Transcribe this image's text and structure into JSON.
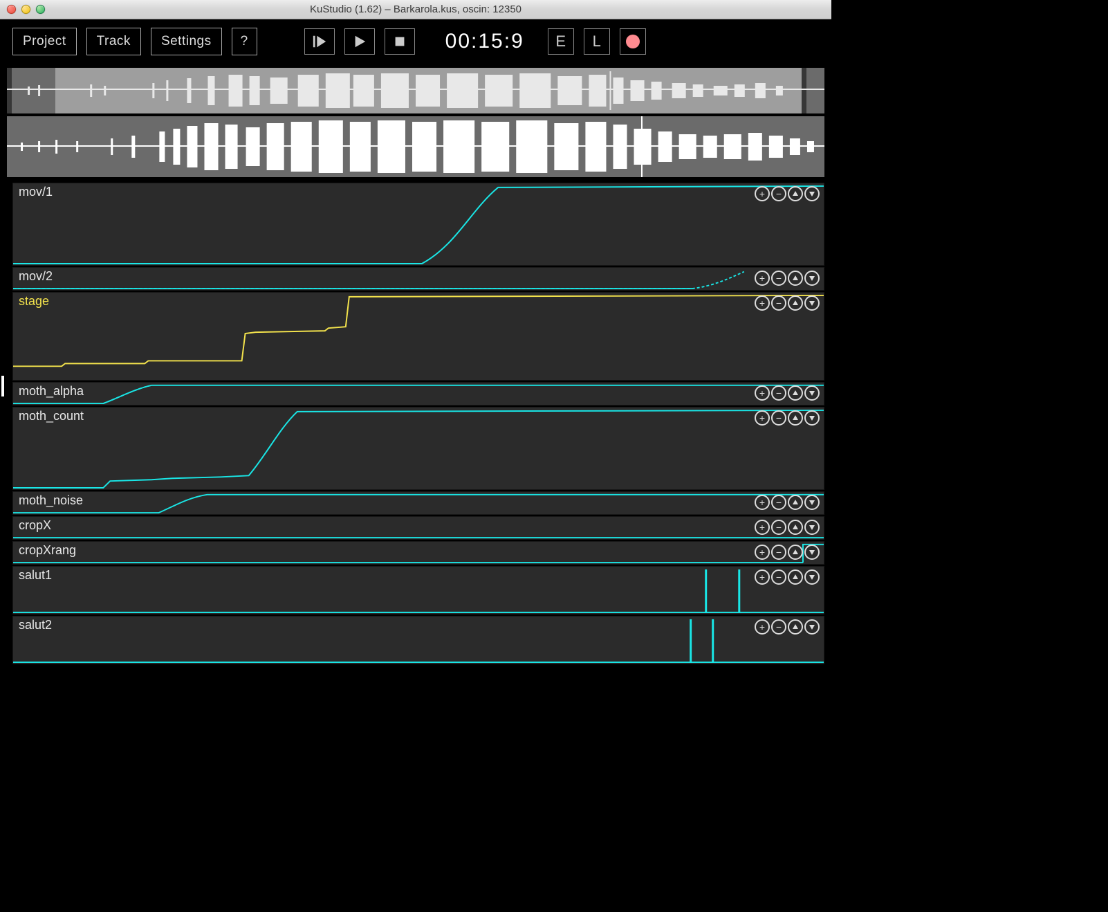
{
  "window": {
    "title": "KuStudio (1.62) – Barkarola.kus, oscin: 12350"
  },
  "toolbar": {
    "project": "Project",
    "track": "Track",
    "settings": "Settings",
    "help": "?",
    "timecode": "00:15:9",
    "e_button": "E",
    "l_button": "L"
  },
  "tracks": [
    {
      "name": "mov/1",
      "height": "med",
      "color": "cyan"
    },
    {
      "name": "mov/2",
      "height": "small",
      "color": "cyan"
    },
    {
      "name": "stage",
      "height": "tall",
      "color": "yellow"
    },
    {
      "name": "moth_alpha",
      "height": "small",
      "color": "cyan"
    },
    {
      "name": "moth_count",
      "height": "med",
      "color": "cyan"
    },
    {
      "name": "moth_noise",
      "height": "small",
      "color": "cyan"
    },
    {
      "name": "cropX",
      "height": "small",
      "color": "cyan"
    },
    {
      "name": "cropXrang",
      "height": "small",
      "color": "cyan"
    },
    {
      "name": "salut1",
      "height": "mid",
      "color": "cyan"
    },
    {
      "name": "salut2",
      "height": "mid",
      "color": "cyan"
    }
  ],
  "icons": {
    "plus": "+",
    "minus": "−",
    "up": "▲",
    "down": "▼"
  }
}
